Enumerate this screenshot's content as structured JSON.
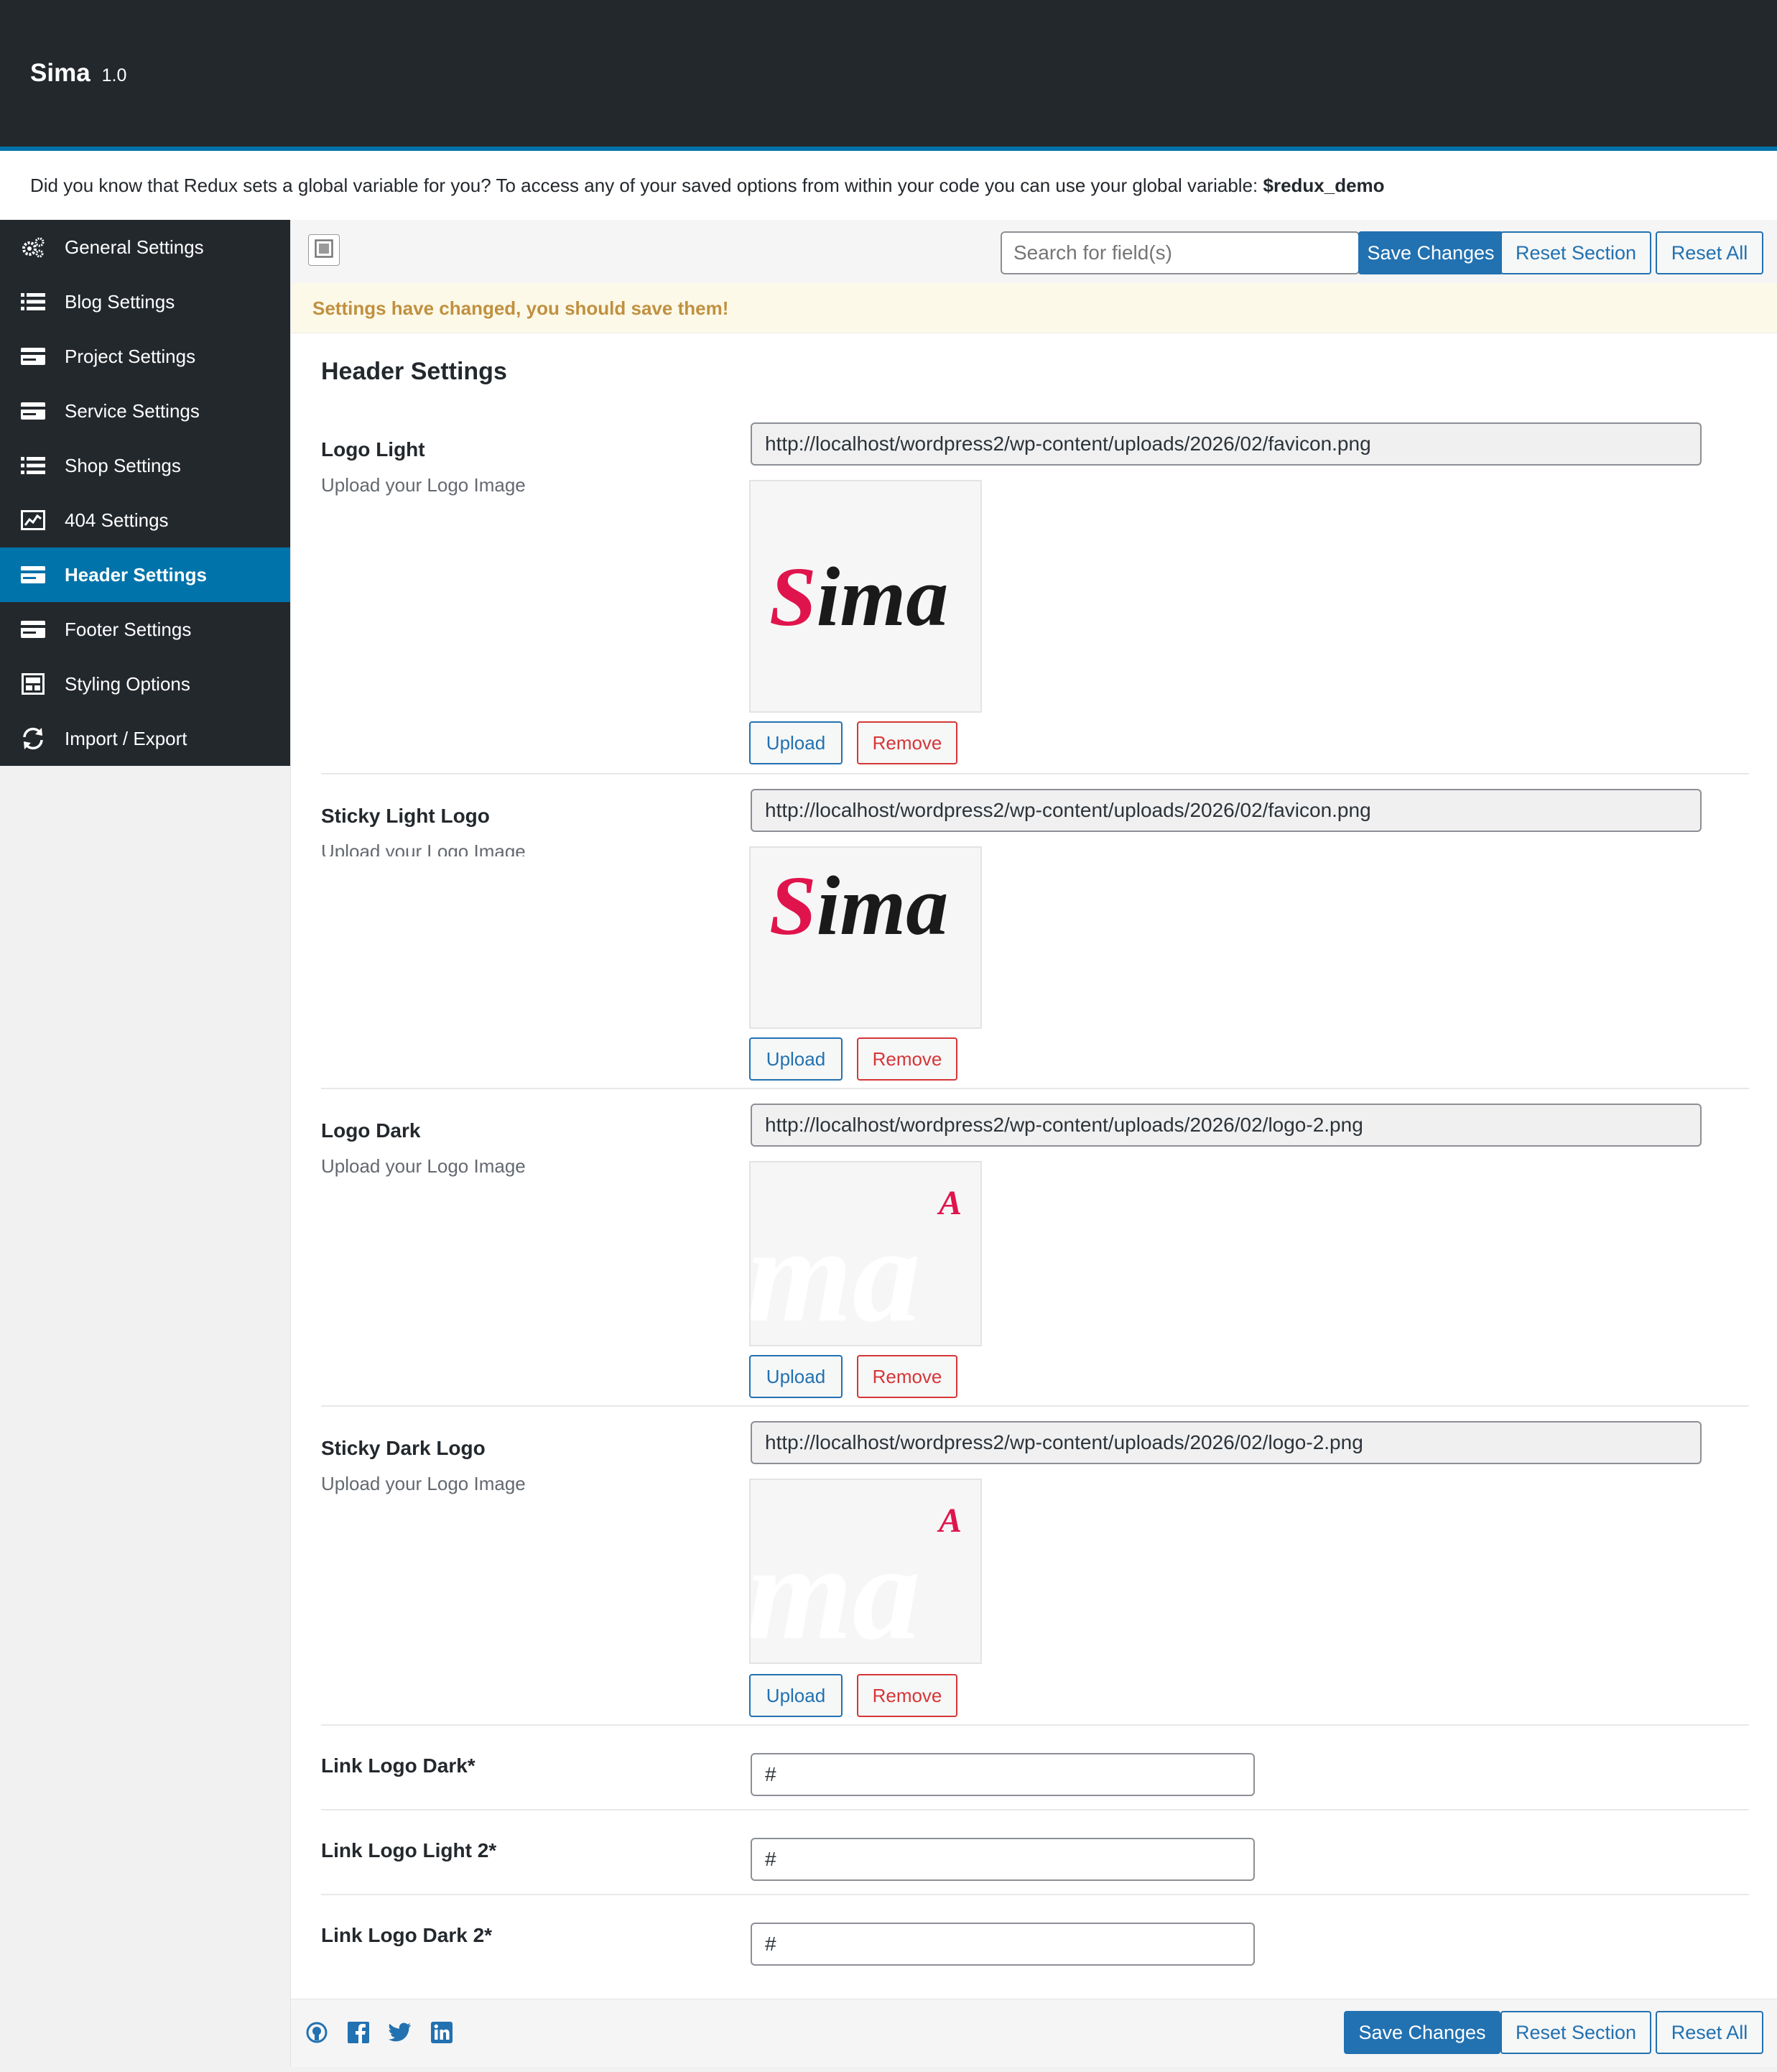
{
  "app": {
    "name": "Sima",
    "version": "1.0"
  },
  "notice": {
    "text": "Did you know that Redux sets a global variable for you? To access any of your saved options from within your code you can use your global variable: ",
    "variable": "$redux_demo"
  },
  "sidebar": {
    "items": [
      {
        "label": "General Settings",
        "icon": "gears-icon"
      },
      {
        "label": "Blog Settings",
        "icon": "list-icon"
      },
      {
        "label": "Project Settings",
        "icon": "card-icon"
      },
      {
        "label": "Service Settings",
        "icon": "card-icon"
      },
      {
        "label": "Shop Settings",
        "icon": "list-icon"
      },
      {
        "label": "404 Settings",
        "icon": "chart-icon"
      },
      {
        "label": "Header Settings",
        "icon": "card-icon",
        "active": true
      },
      {
        "label": "Footer Settings",
        "icon": "card-icon"
      },
      {
        "label": "Styling Options",
        "icon": "layout-icon"
      },
      {
        "label": "Import / Export",
        "icon": "refresh-icon"
      }
    ]
  },
  "toolbar": {
    "search_placeholder": "Search for field(s)",
    "save_label": "Save Changes",
    "reset_section_label": "Reset Section",
    "reset_all_label": "Reset All"
  },
  "warning": "Settings have changed, you should save them!",
  "section": {
    "title": "Header Settings",
    "fields": [
      {
        "label": "Logo Light",
        "desc": "Upload your Logo Image",
        "url": "http://localhost/wordpress2/wp-content/uploads/2026/02/favicon.png",
        "preview_text": "Sima"
      },
      {
        "label": "Sticky Light Logo",
        "desc": "Upload your Logo Image",
        "url": "http://localhost/wordpress2/wp-content/uploads/2026/02/favicon.png",
        "preview_text": "Sima"
      },
      {
        "label": "Logo Dark",
        "desc": "Upload your Logo Image",
        "url": "http://localhost/wordpress2/wp-content/uploads/2026/02/logo-2.png",
        "preview_text": "ma",
        "preview_accent": "A"
      },
      {
        "label": "Sticky Dark Logo",
        "desc": "Upload your Logo Image",
        "url": "http://localhost/wordpress2/wp-content/uploads/2026/02/logo-2.png",
        "preview_text": "ma",
        "preview_accent": "A"
      }
    ],
    "upload_label": "Upload",
    "remove_label": "Remove",
    "links": [
      {
        "label": "Link Logo Dark*",
        "value": "#"
      },
      {
        "label": "Link Logo Light 2*",
        "value": "#"
      },
      {
        "label": "Link Logo Dark 2*",
        "value": "#"
      }
    ]
  },
  "footer": {
    "social": [
      "github-icon",
      "facebook-icon",
      "twitter-icon",
      "linkedin-icon"
    ]
  },
  "colors": {
    "accent": "#0073aa",
    "button": "#2271b1",
    "dark": "#23282d",
    "logo_red": "#e0144c"
  }
}
